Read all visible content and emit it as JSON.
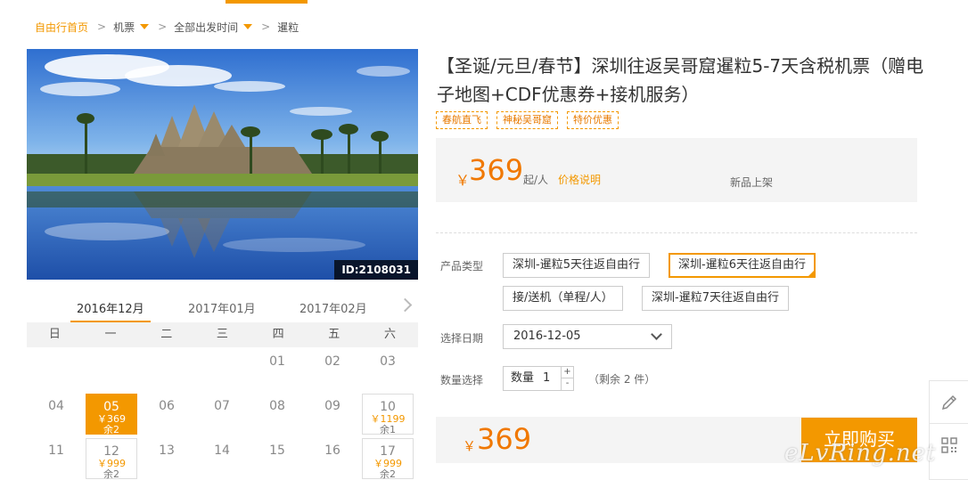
{
  "breadcrumb": {
    "home": "自由行首页",
    "sep": ">",
    "items": [
      "机票",
      "全部出发时间",
      "暹粒"
    ]
  },
  "hero": {
    "id_badge": "ID:2108031"
  },
  "calendar": {
    "months": [
      "2016年12月",
      "2017年01月",
      "2017年02月"
    ],
    "weekdays": [
      "日",
      "一",
      "二",
      "三",
      "四",
      "五",
      "六"
    ],
    "days": [
      {
        "d": "01"
      },
      {
        "d": "02"
      },
      {
        "d": "03"
      },
      {
        "d": "04"
      },
      {
        "d": "05",
        "price": "￥369",
        "stock": "余2"
      },
      {
        "d": "06"
      },
      {
        "d": "07"
      },
      {
        "d": "08"
      },
      {
        "d": "09"
      },
      {
        "d": "10",
        "price": "￥1199",
        "stock": "余1"
      },
      {
        "d": "11"
      },
      {
        "d": "12",
        "price": "￥999",
        "stock": "余2"
      },
      {
        "d": "13"
      },
      {
        "d": "14"
      },
      {
        "d": "15"
      },
      {
        "d": "16"
      },
      {
        "d": "17",
        "price": "￥999",
        "stock": "余2"
      }
    ]
  },
  "product": {
    "title": "【圣诞/元旦/春节】深圳往返吴哥窟暹粒5-7天含税机票（赠电子地图+CDF优惠券+接机服务）",
    "tags": [
      "春航直飞",
      "神秘吴哥窟",
      "特价优惠"
    ],
    "price_symbol": "￥",
    "price": "369",
    "price_unit": "起/人",
    "price_explain": "价格说明",
    "new_label": "新品上架"
  },
  "options": {
    "type_label": "产品类型",
    "types": [
      "深圳-暹粒5天往返自由行",
      "深圳-暹粒6天往返自由行",
      "接/送机（单程/人）",
      "深圳-暹粒7天往返自由行"
    ],
    "date_label": "选择日期",
    "date_value": "2016-12-05",
    "qty_label": "数量选择",
    "qty_text": "数量",
    "qty_value": "1",
    "qty_up": "+",
    "qty_down": "-",
    "remain": "（剩余 2 件）"
  },
  "buy": {
    "price_symbol": "￥",
    "price": "369",
    "button": "立即购买"
  },
  "watermark": "eLvRing.net",
  "colors": {
    "accent": "#f39800",
    "price": "#f07800"
  }
}
